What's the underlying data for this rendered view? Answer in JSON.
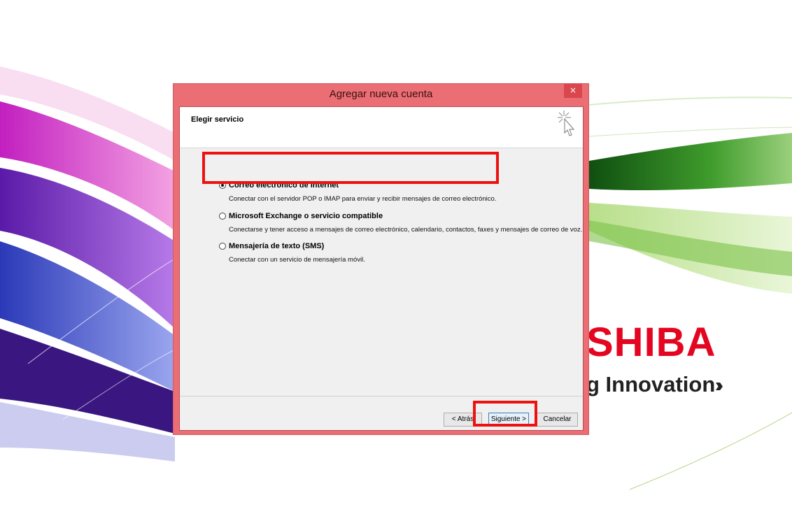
{
  "wallpaper": {
    "brand_text": "SHIBA",
    "tagline": "g Innovation",
    "chevrons": "›››"
  },
  "dialog": {
    "title": "Agregar nueva cuenta",
    "close_glyph": "×",
    "header_title": "Elegir servicio",
    "options": [
      {
        "label": "Correo electrónico de Internet",
        "description": "Conectar con el servidor POP o IMAP para enviar y recibir mensajes de correo electrónico.",
        "selected": true
      },
      {
        "label": "Microsoft Exchange o servicio compatible",
        "description": "Conectarse y tener acceso a mensajes de correo electrónico, calendario, contactos, faxes y mensajes de correo de voz.",
        "selected": false
      },
      {
        "label": "Mensajería de texto (SMS)",
        "description": "Conectar con un servicio de mensajería móvil.",
        "selected": false
      }
    ],
    "buttons": {
      "back": "< Atrás",
      "next": "Siguiente >",
      "cancel": "Cancelar"
    }
  },
  "colors": {
    "dialog_frame": "#ea6e74",
    "highlight": "#ee1111",
    "brand_red": "#e40521"
  },
  "icons": [
    "close-icon",
    "wizard-cursor-icon",
    "radio-icon"
  ]
}
